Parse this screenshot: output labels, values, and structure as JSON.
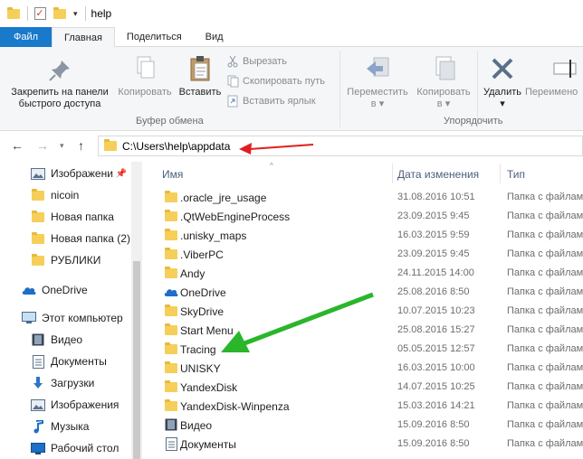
{
  "window": {
    "title": "help"
  },
  "ribbon_tabs": [
    "Файл",
    "Главная",
    "Поделиться",
    "Вид"
  ],
  "ribbon": {
    "pin_label_1": "Закрепить на панели",
    "pin_label_2": "быстрого доступа",
    "copy_label": "Копировать",
    "paste_label": "Вставить",
    "cut_label": "Вырезать",
    "copy_path_label": "Скопировать путь",
    "paste_shortcut_label": "Вставить ярлык",
    "clipboard_group": "Буфер обмена",
    "move_to_label_1": "Переместить",
    "move_to_label_2": "в",
    "copy_to_label_1": "Копировать",
    "copy_to_label_2": "в",
    "delete_label": "Удалить",
    "rename_label": "Переимено",
    "organize_group": "Упорядочить"
  },
  "address": {
    "path": "C:\\Users\\help\\appdata"
  },
  "nav_pane": {
    "items": [
      {
        "label": "Изображени",
        "icon": "pictures-icon",
        "pinned": true
      },
      {
        "label": "nicoin",
        "icon": "folder-icon"
      },
      {
        "label": "Новая папка",
        "icon": "folder-icon"
      },
      {
        "label": "Новая папка (2)",
        "icon": "folder-icon"
      },
      {
        "label": "РУБЛИКИ",
        "icon": "folder-icon"
      },
      {
        "label": "OneDrive",
        "icon": "onedrive-icon"
      },
      {
        "label": "Этот компьютер",
        "icon": "computer-icon"
      },
      {
        "label": "Видео",
        "icon": "video-icon"
      },
      {
        "label": "Документы",
        "icon": "documents-icon"
      },
      {
        "label": "Загрузки",
        "icon": "downloads-icon"
      },
      {
        "label": "Изображения",
        "icon": "pictures-icon"
      },
      {
        "label": "Музыка",
        "icon": "music-icon"
      },
      {
        "label": "Рабочий стол",
        "icon": "desktop-icon"
      }
    ]
  },
  "file_list": {
    "columns": {
      "name": "Имя",
      "date": "Дата изменения",
      "type": "Тип"
    },
    "rows": [
      {
        "name": ".oracle_jre_usage",
        "date": "31.08.2016 10:51",
        "type": "Папка с файлами",
        "icon": "folder-icon"
      },
      {
        "name": ".QtWebEngineProcess",
        "date": "23.09.2015 9:45",
        "type": "Папка с файлами",
        "icon": "folder-icon"
      },
      {
        "name": ".unisky_maps",
        "date": "16.03.2015 9:59",
        "type": "Папка с файлами",
        "icon": "folder-icon"
      },
      {
        "name": ".ViberPC",
        "date": "23.09.2015 9:45",
        "type": "Папка с файлами",
        "icon": "folder-icon"
      },
      {
        "name": "Andy",
        "date": "24.11.2015 14:00",
        "type": "Папка с файлами",
        "icon": "folder-icon"
      },
      {
        "name": "OneDrive",
        "date": "25.08.2016 8:50",
        "type": "Папка с файлами",
        "icon": "onedrive-icon"
      },
      {
        "name": "SkyDrive",
        "date": "10.07.2015 10:23",
        "type": "Папка с файлами",
        "icon": "folder-icon"
      },
      {
        "name": "Start Menu",
        "date": "25.08.2016 15:27",
        "type": "Папка с файлами",
        "icon": "folder-icon"
      },
      {
        "name": "Tracing",
        "date": "05.05.2015 12:57",
        "type": "Папка с файлами",
        "icon": "folder-icon"
      },
      {
        "name": "UNISKY",
        "date": "16.03.2015 10:00",
        "type": "Папка с файлами",
        "icon": "folder-icon"
      },
      {
        "name": "YandexDisk",
        "date": "14.07.2015 10:25",
        "type": "Папка с файлами",
        "icon": "folder-icon"
      },
      {
        "name": "YandexDisk-Winpenza",
        "date": "15.03.2016 14:21",
        "type": "Папка с файлами",
        "icon": "folder-icon"
      },
      {
        "name": "Видео",
        "date": "15.09.2016 8:50",
        "type": "Папка с файлами",
        "icon": "video-icon"
      },
      {
        "name": "Документы",
        "date": "15.09.2016 8:50",
        "type": "Папка с файлами",
        "icon": "documents-icon"
      }
    ]
  },
  "colors": {
    "file_tab": "#1979ca",
    "annotation_red": "#e02020",
    "annotation_green": "#2bb52b",
    "folder": "#f5cf5a"
  }
}
